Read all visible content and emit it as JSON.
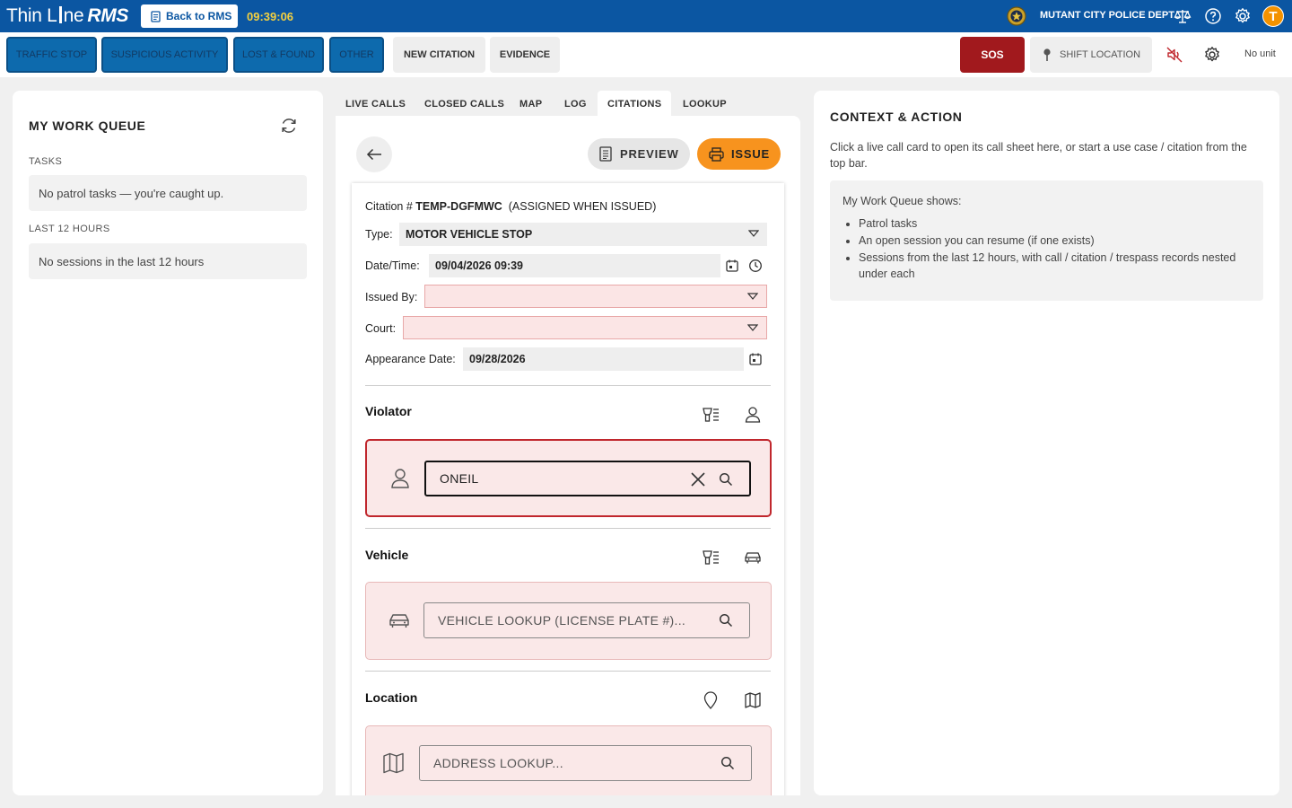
{
  "app": {
    "logo_text": "Thin L",
    "logo_text2": "ne",
    "logo_rms": "RMS",
    "back_label": "Back to RMS",
    "clock": "09:39:06",
    "dept": "MUTANT CITY POLICE DEPT",
    "avatar_letter": "T"
  },
  "actions": {
    "traffic_stop": "TRAFFIC STOP",
    "suspicious": "SUSPICIOUS ACTIVITY",
    "lost_found": "LOST & FOUND",
    "other": "OTHER",
    "new_citation": "NEW CITATION",
    "evidence": "EVIDENCE",
    "sos": "SOS",
    "shift_location": "SHIFT LOCATION",
    "no_unit": "No unit"
  },
  "work_queue": {
    "title": "MY WORK QUEUE",
    "tasks_label": "TASKS",
    "tasks_empty": "No patrol tasks — you're caught up.",
    "last12_label": "LAST 12 HOURS",
    "last12_empty": "No sessions in the last 12 hours"
  },
  "tabs": [
    "LIVE CALLS",
    "CLOSED CALLS",
    "MAP",
    "LOG",
    "CITATIONS",
    "LOOKUP"
  ],
  "citation": {
    "preview_label": "PREVIEW",
    "issue_label": "ISSUE",
    "number_prefix": "Citation #",
    "number": "TEMP-DGFMWC",
    "number_note": "(ASSIGNED WHEN ISSUED)",
    "type_label": "Type:",
    "type_value": "MOTOR VEHICLE STOP",
    "datetime_label": "Date/Time:",
    "datetime_value": "09/04/2026 09:39",
    "issued_by_label": "Issued By:",
    "issued_by_value": "",
    "court_label": "Court:",
    "court_value": "",
    "appearance_label": "Appearance Date:",
    "appearance_value": "09/28/2026",
    "violator_title": "Violator",
    "violator_search_value": "ONEIL",
    "vehicle_title": "Vehicle",
    "vehicle_placeholder": "VEHICLE LOOKUP (LICENSE PLATE #)...",
    "location_title": "Location",
    "location_placeholder": "ADDRESS LOOKUP..."
  },
  "context": {
    "title": "CONTEXT & ACTION",
    "description": "Click a live call card to open its call sheet here, or start a use case / citation from the top bar.",
    "box_intro": "My Work Queue shows:",
    "box_items": [
      "Patrol tasks",
      "An open session you can resume (if one exists)",
      "Sessions from the last 12 hours, with call / citation / trespass records nested under each"
    ]
  },
  "colors": {
    "brand_blue": "#0b56a2",
    "clock_yellow": "#f4d03f",
    "sos_red": "#a1191d",
    "issue_orange": "#f7931e",
    "required_pink": "#fbe5e5",
    "error_red": "#c0272d"
  },
  "icons": [
    "document-icon",
    "police-badge-icon",
    "scales-icon",
    "help-icon",
    "gear-icon",
    "pin-icon",
    "muted-speaker-icon",
    "refresh-icon",
    "arrow-left-icon",
    "printer-icon",
    "calendar-icon",
    "clock-icon",
    "chevron-down-icon",
    "id-list-icon",
    "person-icon",
    "car-icon",
    "location-pin-icon",
    "map-icon",
    "search-icon",
    "close-icon"
  ]
}
